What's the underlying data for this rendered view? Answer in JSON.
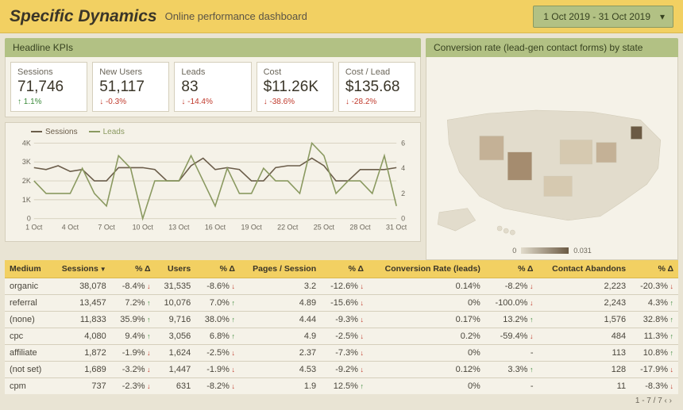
{
  "header": {
    "title": "Specific Dynamics",
    "subtitle": "Online performance dashboard",
    "date_range": "1 Oct 2019 - 31 Oct 2019"
  },
  "panels": {
    "kpi_title": "Headline KPIs",
    "map_title": "Conversion rate (lead-gen contact forms) by state"
  },
  "kpis": [
    {
      "label": "Sessions",
      "value": "71,746",
      "delta": "1.1%",
      "dir": "up"
    },
    {
      "label": "New Users",
      "value": "51,117",
      "delta": "-0.3%",
      "dir": "down"
    },
    {
      "label": "Leads",
      "value": "83",
      "delta": "-14.4%",
      "dir": "down"
    },
    {
      "label": "Cost",
      "value": "$11.26K",
      "delta": "-38.6%",
      "dir": "down"
    },
    {
      "label": "Cost / Lead",
      "value": "$135.68",
      "delta": "-28.2%",
      "dir": "down"
    }
  ],
  "chart_legend": {
    "a": "Sessions",
    "b": "Leads"
  },
  "chart_data": {
    "type": "line",
    "xlabel": "",
    "ylabel_left": "",
    "ylabel_right": "",
    "y_left_range": [
      0,
      4000
    ],
    "y_right_range": [
      0,
      6
    ],
    "x_ticks": [
      "1 Oct",
      "4 Oct",
      "7 Oct",
      "10 Oct",
      "13 Oct",
      "16 Oct",
      "19 Oct",
      "22 Oct",
      "25 Oct",
      "28 Oct",
      "31 Oct"
    ],
    "series": [
      {
        "name": "Sessions",
        "axis": "left",
        "color": "#6b5d4a",
        "x": [
          1,
          2,
          3,
          4,
          5,
          6,
          7,
          8,
          9,
          10,
          11,
          12,
          13,
          14,
          15,
          16,
          17,
          18,
          19,
          20,
          21,
          22,
          23,
          24,
          25,
          26,
          27,
          28,
          29,
          30,
          31
        ],
        "y": [
          2700,
          2600,
          2800,
          2500,
          2600,
          2000,
          2000,
          2700,
          2700,
          2700,
          2600,
          2000,
          2000,
          2800,
          3200,
          2600,
          2700,
          2600,
          2000,
          2000,
          2700,
          2800,
          2800,
          3200,
          2800,
          2000,
          2000,
          2600,
          2600,
          2600,
          2700
        ]
      },
      {
        "name": "Leads",
        "axis": "right",
        "color": "#8a9960",
        "x": [
          1,
          2,
          3,
          4,
          5,
          6,
          7,
          8,
          9,
          10,
          11,
          12,
          13,
          14,
          15,
          16,
          17,
          18,
          19,
          20,
          21,
          22,
          23,
          24,
          25,
          26,
          27,
          28,
          29,
          30,
          31
        ],
        "y": [
          3,
          2,
          2,
          2,
          4,
          2,
          1,
          5,
          4,
          0,
          3,
          3,
          3,
          5,
          3,
          1,
          4,
          2,
          2,
          4,
          3,
          3,
          2,
          6,
          5,
          2,
          3,
          3,
          2,
          5,
          1
        ]
      }
    ]
  },
  "map": {
    "scale_min": "0",
    "scale_max": "0.031"
  },
  "table": {
    "columns": [
      "Medium",
      "Sessions",
      "% Δ",
      "Users",
      "% Δ",
      "Pages / Session",
      "% Δ",
      "Conversion Rate (leads)",
      "% Δ",
      "Contact Abandons",
      "% Δ"
    ],
    "sort_col": "Sessions",
    "rows": [
      {
        "medium": "organic",
        "sessions": "38,078",
        "sessions_d": "-8.4%",
        "sessions_dir": "down",
        "users": "31,535",
        "users_d": "-8.6%",
        "users_dir": "down",
        "pps": "3.2",
        "pps_d": "-12.6%",
        "pps_dir": "down",
        "conv": "0.14%",
        "conv_d": "-8.2%",
        "conv_dir": "down",
        "aban": "2,223",
        "aban_d": "-20.3%",
        "aban_dir": "down"
      },
      {
        "medium": "referral",
        "sessions": "13,457",
        "sessions_d": "7.2%",
        "sessions_dir": "up",
        "users": "10,076",
        "users_d": "7.0%",
        "users_dir": "up",
        "pps": "4.89",
        "pps_d": "-15.6%",
        "pps_dir": "down",
        "conv": "0%",
        "conv_d": "-100.0%",
        "conv_dir": "down",
        "aban": "2,243",
        "aban_d": "4.3%",
        "aban_dir": "up"
      },
      {
        "medium": "(none)",
        "sessions": "11,833",
        "sessions_d": "35.9%",
        "sessions_dir": "up",
        "users": "9,716",
        "users_d": "38.0%",
        "users_dir": "up",
        "pps": "4.44",
        "pps_d": "-9.3%",
        "pps_dir": "down",
        "conv": "0.17%",
        "conv_d": "13.2%",
        "conv_dir": "up",
        "aban": "1,576",
        "aban_d": "32.8%",
        "aban_dir": "up"
      },
      {
        "medium": "cpc",
        "sessions": "4,080",
        "sessions_d": "9.4%",
        "sessions_dir": "up",
        "users": "3,056",
        "users_d": "6.8%",
        "users_dir": "up",
        "pps": "4.9",
        "pps_d": "-2.5%",
        "pps_dir": "down",
        "conv": "0.2%",
        "conv_d": "-59.4%",
        "conv_dir": "down",
        "aban": "484",
        "aban_d": "11.3%",
        "aban_dir": "up"
      },
      {
        "medium": "affiliate",
        "sessions": "1,872",
        "sessions_d": "-1.9%",
        "sessions_dir": "down",
        "users": "1,624",
        "users_d": "-2.5%",
        "users_dir": "down",
        "pps": "2.37",
        "pps_d": "-7.3%",
        "pps_dir": "down",
        "conv": "0%",
        "conv_d": "-",
        "conv_dir": "",
        "aban": "113",
        "aban_d": "10.8%",
        "aban_dir": "up"
      },
      {
        "medium": "(not set)",
        "sessions": "1,689",
        "sessions_d": "-3.2%",
        "sessions_dir": "down",
        "users": "1,447",
        "users_d": "-1.9%",
        "users_dir": "down",
        "pps": "4.53",
        "pps_d": "-9.2%",
        "pps_dir": "down",
        "conv": "0.12%",
        "conv_d": "3.3%",
        "conv_dir": "up",
        "aban": "128",
        "aban_d": "-17.9%",
        "aban_dir": "down"
      },
      {
        "medium": "cpm",
        "sessions": "737",
        "sessions_d": "-2.3%",
        "sessions_dir": "down",
        "users": "631",
        "users_d": "-8.2%",
        "users_dir": "down",
        "pps": "1.9",
        "pps_d": "12.5%",
        "pps_dir": "up",
        "conv": "0%",
        "conv_d": "-",
        "conv_dir": "",
        "aban": "11",
        "aban_d": "-8.3%",
        "aban_dir": "down"
      }
    ],
    "pager": "1 - 7 / 7"
  }
}
